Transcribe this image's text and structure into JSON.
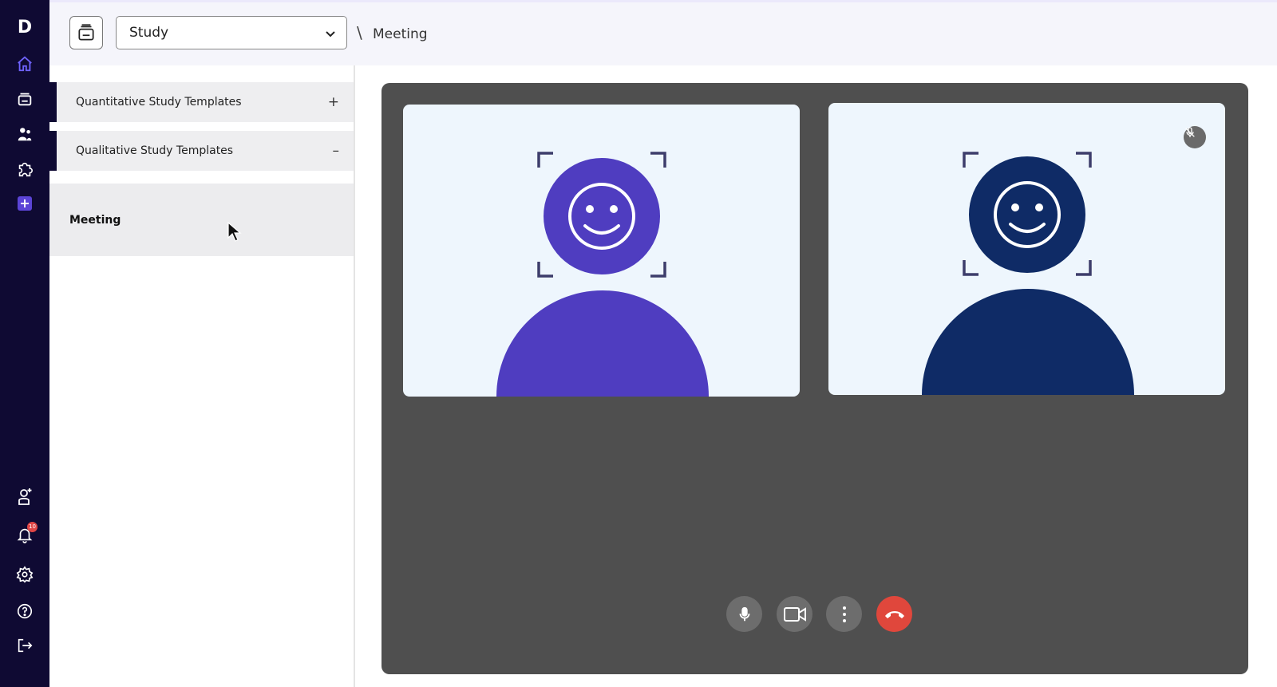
{
  "rail": {
    "logo": "D",
    "notification_count": "10"
  },
  "header": {
    "study_select": {
      "value": "Study"
    },
    "breadcrumb_separator": "\\",
    "breadcrumb_current": "Meeting"
  },
  "panel": {
    "sections": [
      {
        "label": "Quantitative Study Templates",
        "toggle": "+"
      },
      {
        "label": "Qualitative Study Templates",
        "toggle": "–"
      }
    ],
    "selected_item": "Meeting"
  },
  "meeting": {
    "participants": [
      {
        "color": "#4f3dc0",
        "muted": false
      },
      {
        "color": "#0f2b66",
        "muted": true
      }
    ],
    "controls": [
      "microphone",
      "camera",
      "more-options",
      "end-call"
    ]
  },
  "colors": {
    "rail_bg": "#0f0a33",
    "stage_bg": "#4f4f4f",
    "tile_bg": "#eef6fd",
    "end_call": "#e0473c",
    "accent": "#4f3dc0"
  }
}
